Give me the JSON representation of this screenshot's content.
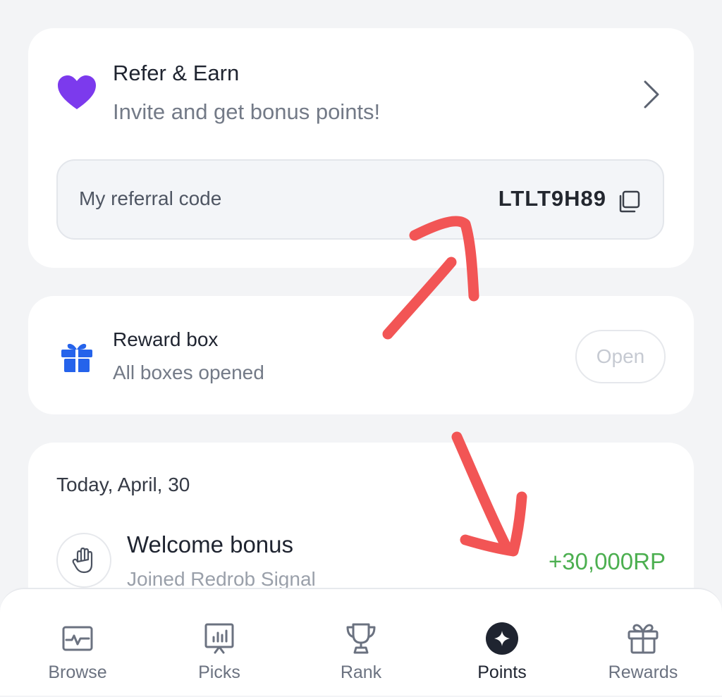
{
  "refer": {
    "title": "Refer & Earn",
    "subtitle": "Invite and get bonus points!",
    "icon": "heart-icon",
    "code_label": "My referral code",
    "code": "LTLT9H89"
  },
  "reward_box": {
    "title": "Reward box",
    "subtitle": "All boxes opened",
    "button_label": "Open",
    "icon": "gift-icon"
  },
  "history": {
    "date": "Today, April, 30",
    "items": [
      {
        "title": "Welcome bonus",
        "subtitle": "Joined Redrob Signal",
        "amount": "+30,000RP",
        "icon": "hand-icon"
      }
    ]
  },
  "nav": {
    "items": [
      {
        "label": "Browse",
        "icon": "browse-icon",
        "active": false
      },
      {
        "label": "Picks",
        "icon": "picks-icon",
        "active": false
      },
      {
        "label": "Rank",
        "icon": "trophy-icon",
        "active": false
      },
      {
        "label": "Points",
        "icon": "points-icon",
        "active": true
      },
      {
        "label": "Rewards",
        "icon": "rewards-gift-icon",
        "active": false
      }
    ]
  },
  "colors": {
    "accent_purple": "#7c3aed",
    "accent_blue": "#2563eb",
    "positive_green": "#4caf50",
    "annotation_red": "#f25555"
  }
}
